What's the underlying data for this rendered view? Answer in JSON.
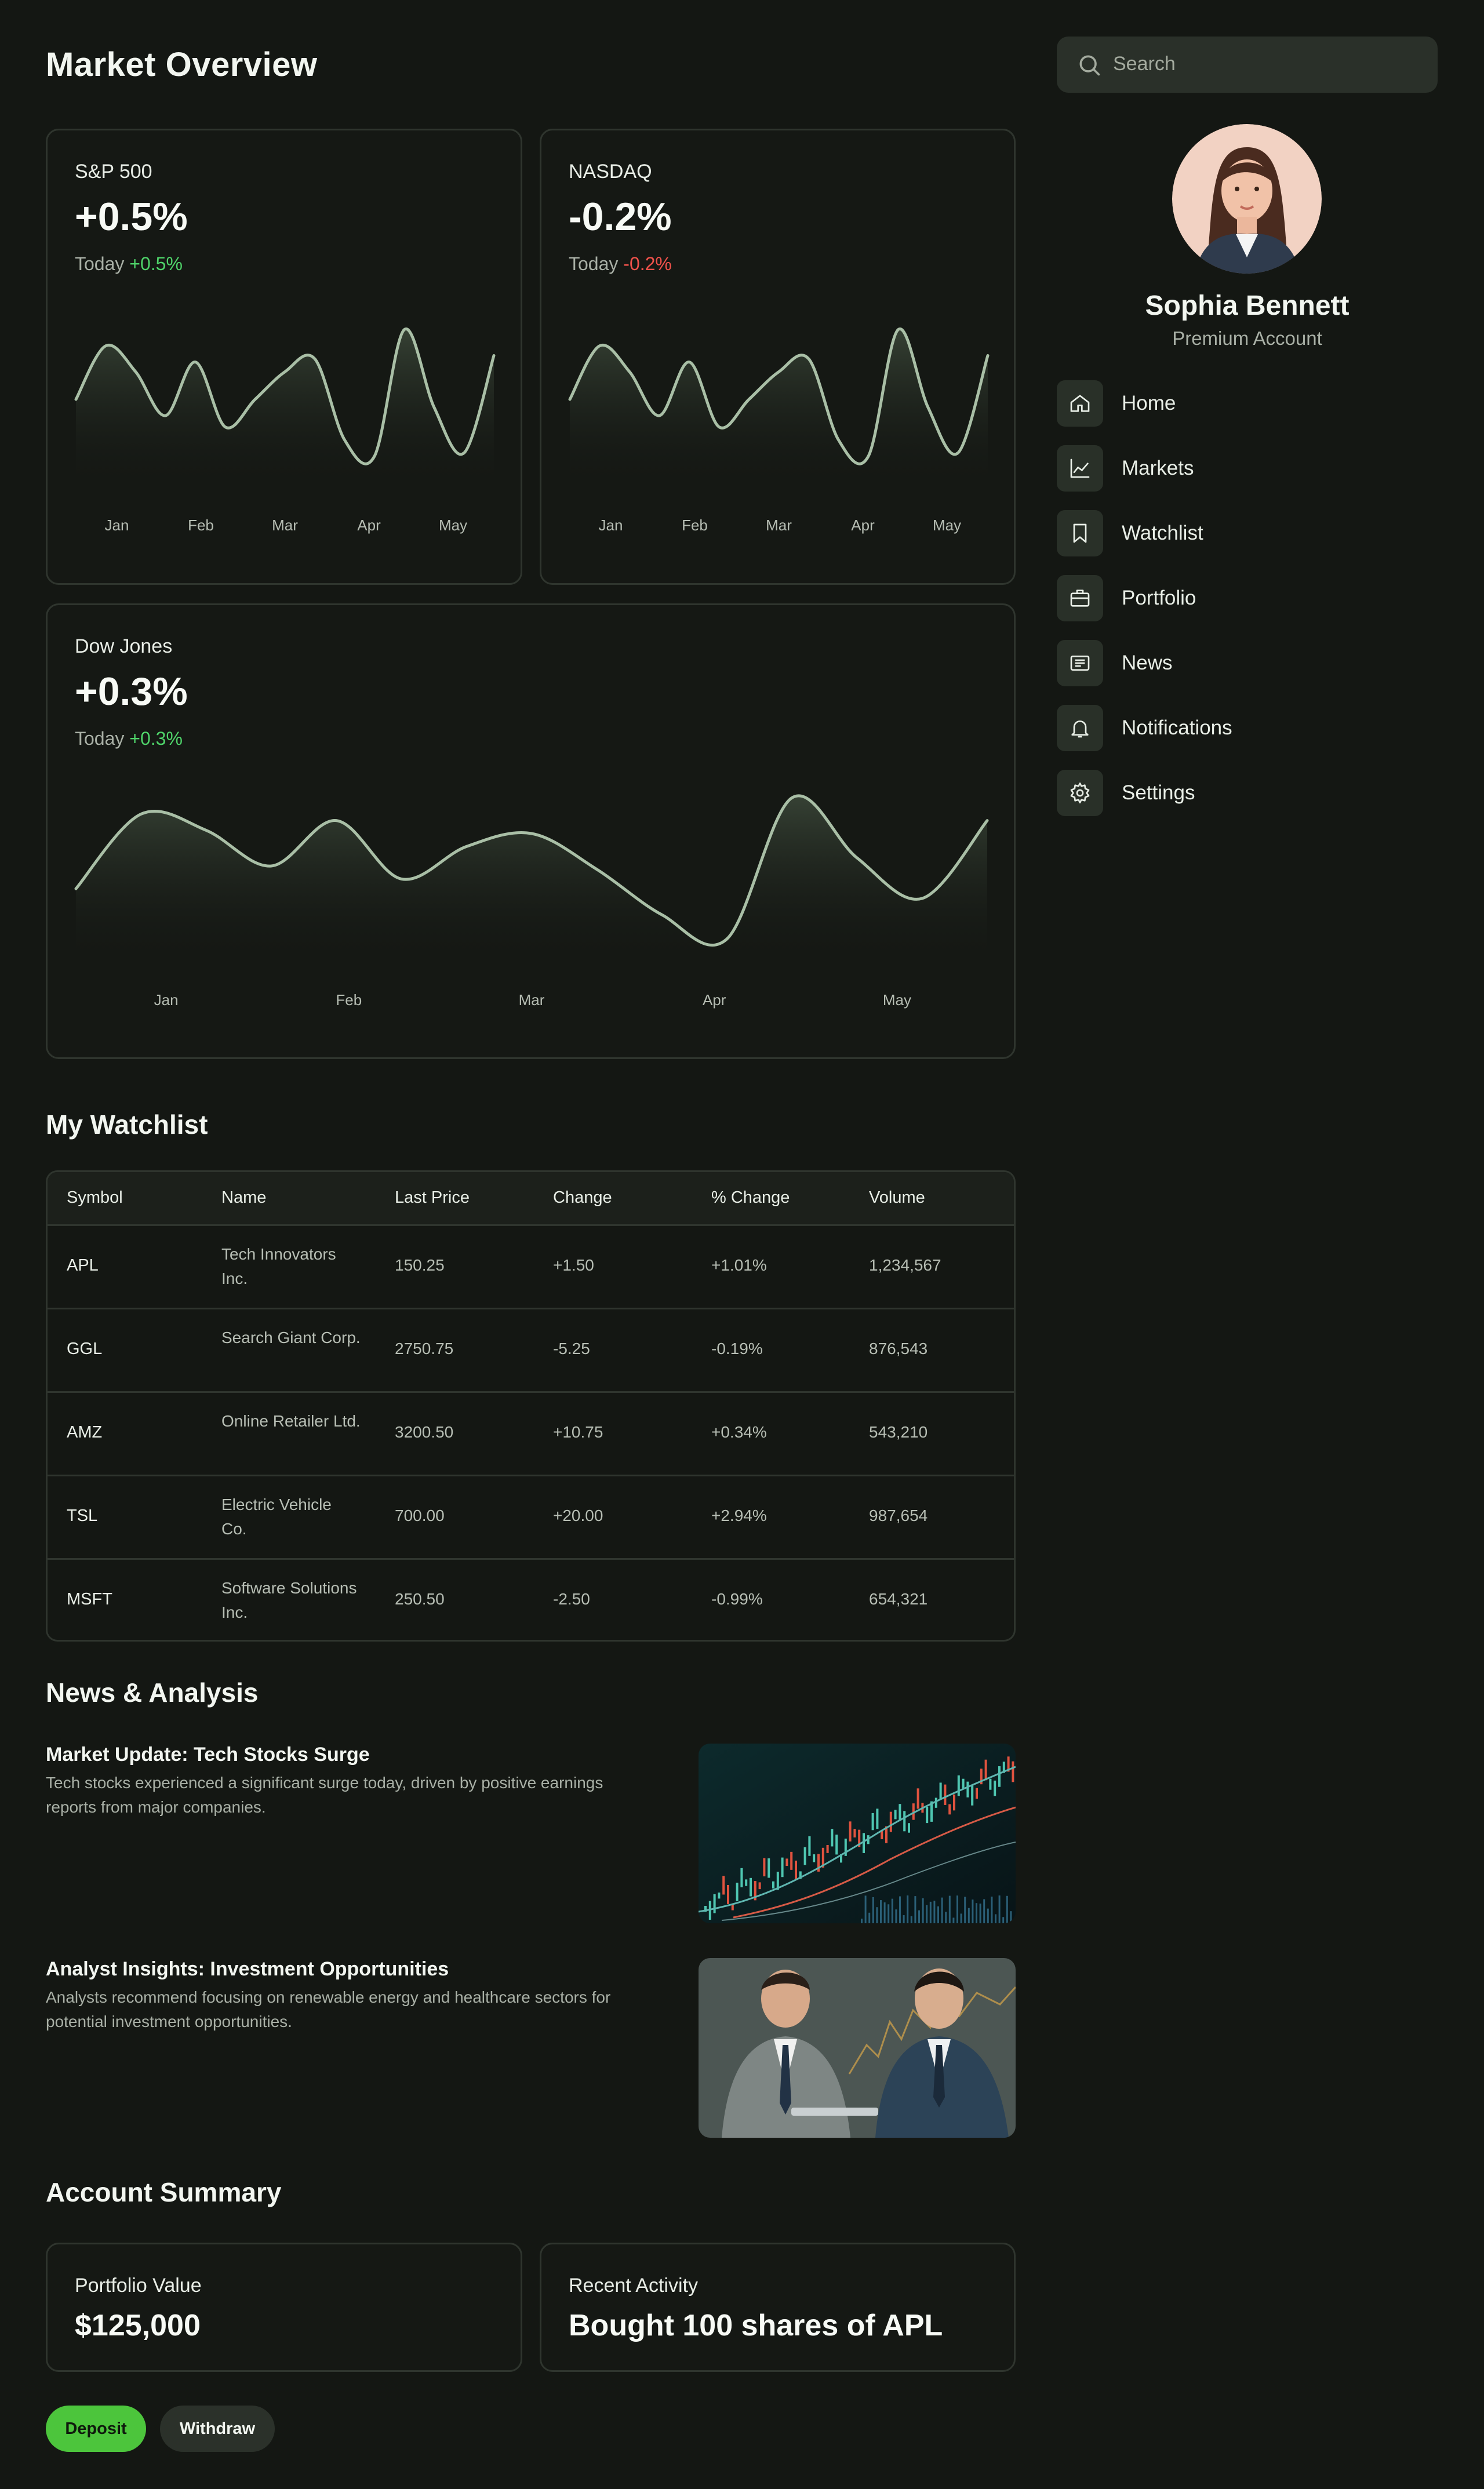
{
  "page": {
    "title": "Market Overview"
  },
  "indices": [
    {
      "name": "S&P 500",
      "value": "+0.5%",
      "today_label": "Today",
      "today_change": "+0.5%",
      "direction": "up"
    },
    {
      "name": "NASDAQ",
      "value": "-0.2%",
      "today_label": "Today",
      "today_change": "-0.2%",
      "direction": "down"
    },
    {
      "name": "Dow Jones",
      "value": "+0.3%",
      "today_label": "Today",
      "today_change": "+0.3%",
      "direction": "up"
    }
  ],
  "chart_data": [
    {
      "type": "area",
      "title": "S&P 500",
      "x": [
        "Jan",
        "Feb",
        "Mar",
        "Apr",
        "May"
      ],
      "line_color": "#a9bfa6",
      "y": [
        0.45,
        0.78,
        0.62,
        0.35,
        0.68,
        0.28,
        0.45,
        0.62,
        0.7,
        0.2,
        0.1,
        0.88,
        0.4,
        0.12,
        0.72
      ]
    },
    {
      "type": "area",
      "title": "NASDAQ",
      "x": [
        "Jan",
        "Feb",
        "Mar",
        "Apr",
        "May"
      ],
      "line_color": "#a9bfa6",
      "y": [
        0.45,
        0.78,
        0.62,
        0.35,
        0.68,
        0.28,
        0.45,
        0.62,
        0.7,
        0.2,
        0.1,
        0.88,
        0.4,
        0.12,
        0.72
      ]
    },
    {
      "type": "area",
      "title": "Dow Jones",
      "x": [
        "Jan",
        "Feb",
        "Mar",
        "Apr",
        "May"
      ],
      "line_color": "#a9bfa6",
      "y": [
        0.36,
        0.82,
        0.72,
        0.5,
        0.78,
        0.42,
        0.62,
        0.7,
        0.48,
        0.2,
        0.05,
        0.92,
        0.55,
        0.3,
        0.78
      ]
    }
  ],
  "sidebar": {
    "search_placeholder": "Search",
    "user": {
      "name": "Sophia Bennett",
      "plan": "Premium Account"
    },
    "nav": [
      {
        "label": "Home",
        "icon": "home-icon"
      },
      {
        "label": "Markets",
        "icon": "chart-icon"
      },
      {
        "label": "Watchlist",
        "icon": "bookmark-icon"
      },
      {
        "label": "Portfolio",
        "icon": "briefcase-icon"
      },
      {
        "label": "News",
        "icon": "newspaper-icon"
      },
      {
        "label": "Notifications",
        "icon": "bell-icon"
      },
      {
        "label": "Settings",
        "icon": "gear-icon"
      }
    ]
  },
  "watchlist": {
    "title": "My Watchlist",
    "columns": [
      "Symbol",
      "Name",
      "Last Price",
      "Change",
      "% Change",
      "Volume"
    ],
    "rows": [
      {
        "symbol": "APL",
        "name": "Tech Innovators Inc.",
        "price": "150.25",
        "change": "+1.50",
        "pct": "+1.01%",
        "volume": "1,234,567"
      },
      {
        "symbol": "GGL",
        "name": "Search Giant Corp.",
        "price": "2750.75",
        "change": "-5.25",
        "pct": "-0.19%",
        "volume": "876,543"
      },
      {
        "symbol": "AMZ",
        "name": "Online Retailer Ltd.",
        "price": "3200.50",
        "change": "+10.75",
        "pct": "+0.34%",
        "volume": "543,210"
      },
      {
        "symbol": "TSL",
        "name": "Electric Vehicle Co.",
        "price": "700.00",
        "change": "+20.00",
        "pct": "+2.94%",
        "volume": "987,654"
      },
      {
        "symbol": "MSFT",
        "name": "Software Solutions Inc.",
        "price": "250.50",
        "change": "-2.50",
        "pct": "-0.99%",
        "volume": "654,321"
      }
    ]
  },
  "news": {
    "title": "News & Analysis",
    "items": [
      {
        "headline": "Market Update: Tech Stocks Surge",
        "summary": "Tech stocks experienced a significant surge today, driven by positive earnings reports from major companies."
      },
      {
        "headline": "Analyst Insights: Investment Opportunities",
        "summary": "Analysts recommend focusing on renewable energy and healthcare sectors for potential investment opportunities."
      }
    ]
  },
  "account": {
    "title": "Account Summary",
    "portfolio_label": "Portfolio Value",
    "portfolio_value": "$125,000",
    "activity_label": "Recent Activity",
    "activity_value": "Bought 100 shares of APL",
    "deposit_label": "Deposit",
    "withdraw_label": "Withdraw"
  }
}
